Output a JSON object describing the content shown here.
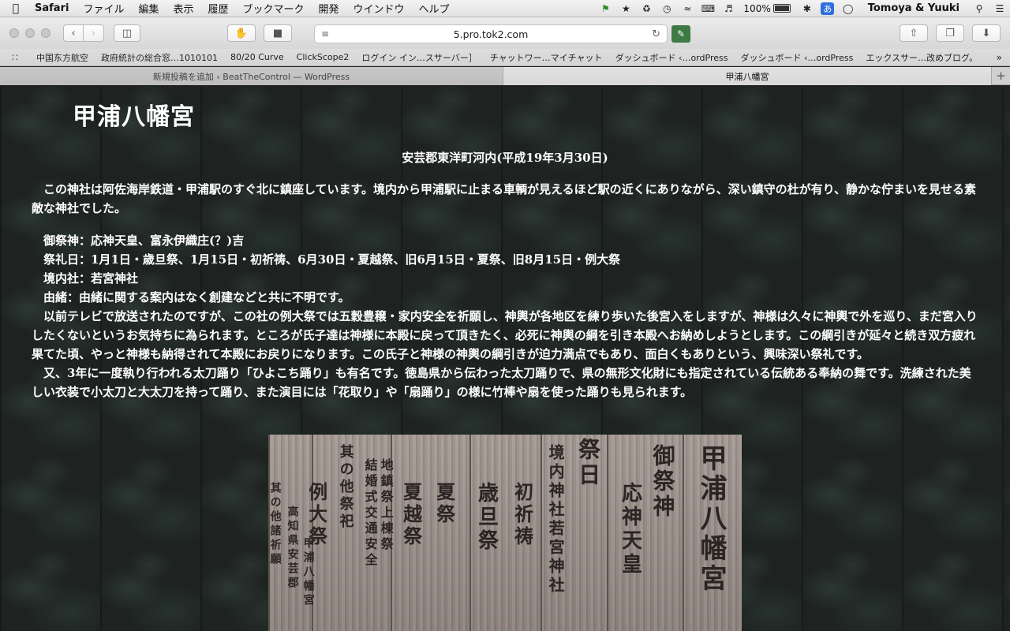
{
  "menubar": {
    "apple": "",
    "app": "Safari",
    "items": [
      "ファイル",
      "編集",
      "表示",
      "履歴",
      "ブックマーク",
      "開発",
      "ウインドウ",
      "ヘルプ"
    ],
    "battery_percent": "100%",
    "battery_level": 1.0,
    "ime": "あ",
    "user": "Tomoya & Yuuki"
  },
  "toolbar": {
    "url": "5.pro.tok2.com"
  },
  "bookmarks": [
    "中国东方航空",
    "政府統計の総合窓…1010101",
    "80/20 Curve",
    "ClickScope2",
    "ログイン イン…スサーバー］",
    "チャットワー…マイチャット",
    "ダッシュボード ‹…ordPress",
    "ダッシュボード ‹…ordPress",
    "エックスサー…改めブログ。"
  ],
  "bookmarks_more": "»",
  "tabs": {
    "inactive": "新規投稿を追加 ‹ BeatTheControl — WordPress",
    "active": "甲浦八幡宮",
    "add": "+"
  },
  "page": {
    "title": "甲浦八幡宮",
    "subtitle": "安芸郡東洋町河内(平成19年3月30日)",
    "intro": "この神社は阿佐海岸鉄道・甲浦駅のすぐ北に鎮座しています。境内から甲浦駅に止まる車輌が見えるほど駅の近くにありながら、深い鎮守の杜が有り、静かな佇まいを見せる素敵な神社でした。",
    "details": [
      "御祭神：応神天皇、富永伊織庄(？)吉",
      "祭礼日：1月1日・歳旦祭、1月15日・初祈祷、6月30日・夏越祭、旧6月15日・夏祭、旧8月15日・例大祭",
      "境内社：若宮神社",
      "由緒：由緒に関する案内はなく創建などと共に不明です。",
      "以前テレビで放送されたのですが、この社の例大祭では五穀豊穣・家内安全を祈願し、神輿が各地区を練り歩いた後宮入をしますが、神様は久々に神輿で外を巡り、まだ宮入りしたくないというお気持ちに為られます。ところが氏子達は神様に本殿に戻って頂きたく、必死に神輿の綱を引き本殿へお納めしようとします。この綱引きが延々と続き双方疲れ果てた頃、やっと神様も納得されて本殿にお戻りになります。この氏子と神様の神輿の綱引きが迫力満点でもあり、面白くもありという、興味深い祭礼です。",
      "又、3年に一度執り行われる太刀踊り「ひよこち踊り」も有名です。徳島県から伝わった太刀踊りで、県の無形文化財にも指定されている伝統ある奉納の舞です。洗練された美しい衣装で小太刀と大太刀を持って踊り、また演目には「花取り」や「扇踊り」の様に竹棒や扇を使った踊りも見られます。"
    ],
    "sign_columns": [
      "甲浦八幡宮",
      "御祭神",
      "応神天皇",
      "境内神社若宮神社",
      "祭日",
      "歳旦祭",
      "初祈祷",
      "夏越祭",
      "夏祭",
      "例大祭",
      "其の他祭祀",
      "結婚式交通安全",
      "地鎮祭上棟祭",
      "其の他諸祈願",
      "高知県安芸郡",
      "甲浦八幡宮"
    ]
  }
}
